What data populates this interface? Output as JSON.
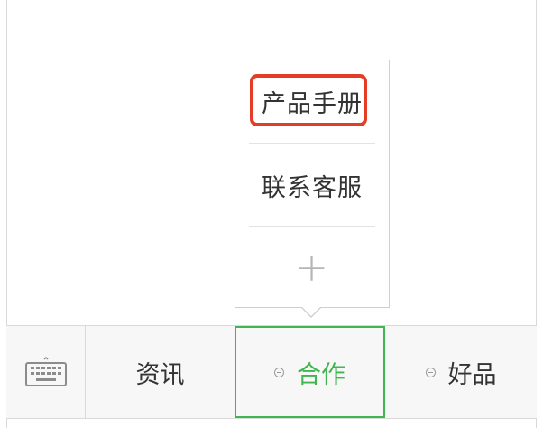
{
  "popup": {
    "items": [
      {
        "label": "产品手册",
        "highlighted": true
      },
      {
        "label": "联系客服"
      }
    ],
    "add_label": "+"
  },
  "menubar": {
    "keyboard_icon": "keyboard-icon",
    "items": [
      {
        "label": "资讯",
        "has_submenu": false,
        "active": false
      },
      {
        "label": "合作",
        "has_submenu": true,
        "active": true
      },
      {
        "label": "好品",
        "has_submenu": true,
        "active": false
      }
    ]
  },
  "colors": {
    "active_border": "#3fb650",
    "active_text": "#3fb650",
    "highlight": "#e53d25",
    "menubar_bg": "#f7f7f7"
  }
}
